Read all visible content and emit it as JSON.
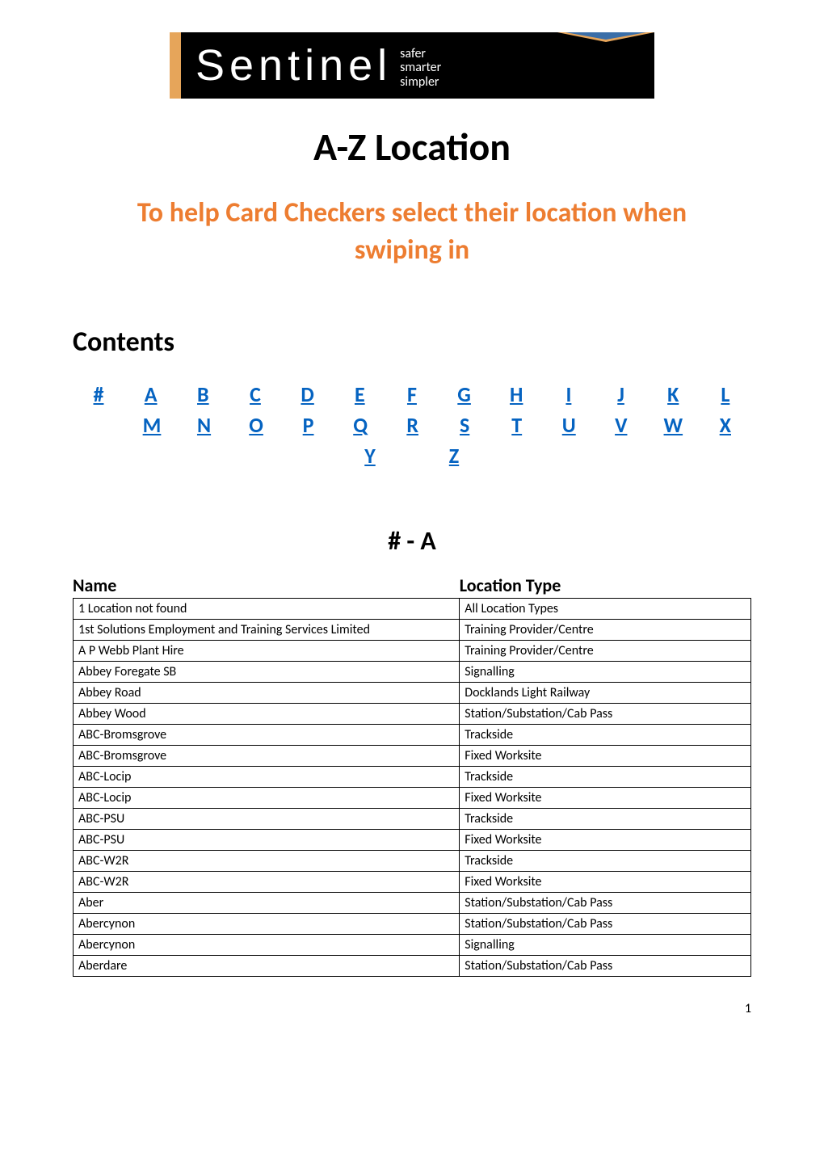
{
  "logo": {
    "word": "Sentinel",
    "tagline_1": "safer",
    "tagline_2": "smarter",
    "tagline_3": "simpler"
  },
  "title": "A-Z Location",
  "subtitle_line1": "To help Card Checkers select their location when",
  "subtitle_line2": "swiping in",
  "contents_heading": "Contents",
  "az_row1": [
    "#",
    "A",
    "B",
    "C",
    "D",
    "E",
    "F",
    "G",
    "H",
    "I",
    "J",
    "K",
    "L"
  ],
  "az_row2": [
    "M",
    "N",
    "O",
    "P",
    "Q",
    "R",
    "S",
    "T",
    "U",
    "V",
    "W",
    "X"
  ],
  "az_row3": [
    "Y",
    "Z"
  ],
  "section_letter": "# - A",
  "table_header_name": "Name",
  "table_header_type": "Location Type",
  "rows": [
    {
      "name": "1 Location not found",
      "type": "All Location Types"
    },
    {
      "name": "1st Solutions Employment and Training Services Limited",
      "type": "Training Provider/Centre"
    },
    {
      "name": "A P Webb Plant Hire",
      "type": "Training Provider/Centre"
    },
    {
      "name": "Abbey Foregate SB",
      "type": "Signalling"
    },
    {
      "name": "Abbey Road",
      "type": "Docklands Light Railway"
    },
    {
      "name": "Abbey Wood",
      "type": "Station/Substation/Cab Pass"
    },
    {
      "name": "ABC-Bromsgrove",
      "type": "Trackside"
    },
    {
      "name": "ABC-Bromsgrove",
      "type": "Fixed Worksite"
    },
    {
      "name": "ABC-Locip",
      "type": "Trackside"
    },
    {
      "name": "ABC-Locip",
      "type": "Fixed Worksite"
    },
    {
      "name": "ABC-PSU",
      "type": "Trackside"
    },
    {
      "name": "ABC-PSU",
      "type": "Fixed Worksite"
    },
    {
      "name": "ABC-W2R",
      "type": "Trackside"
    },
    {
      "name": "ABC-W2R",
      "type": "Fixed Worksite"
    },
    {
      "name": "Aber",
      "type": "Station/Substation/Cab Pass"
    },
    {
      "name": "Abercynon",
      "type": "Station/Substation/Cab Pass"
    },
    {
      "name": "Abercynon",
      "type": "Signalling"
    },
    {
      "name": "Aberdare",
      "type": "Station/Substation/Cab Pass"
    }
  ],
  "page_number": "1"
}
